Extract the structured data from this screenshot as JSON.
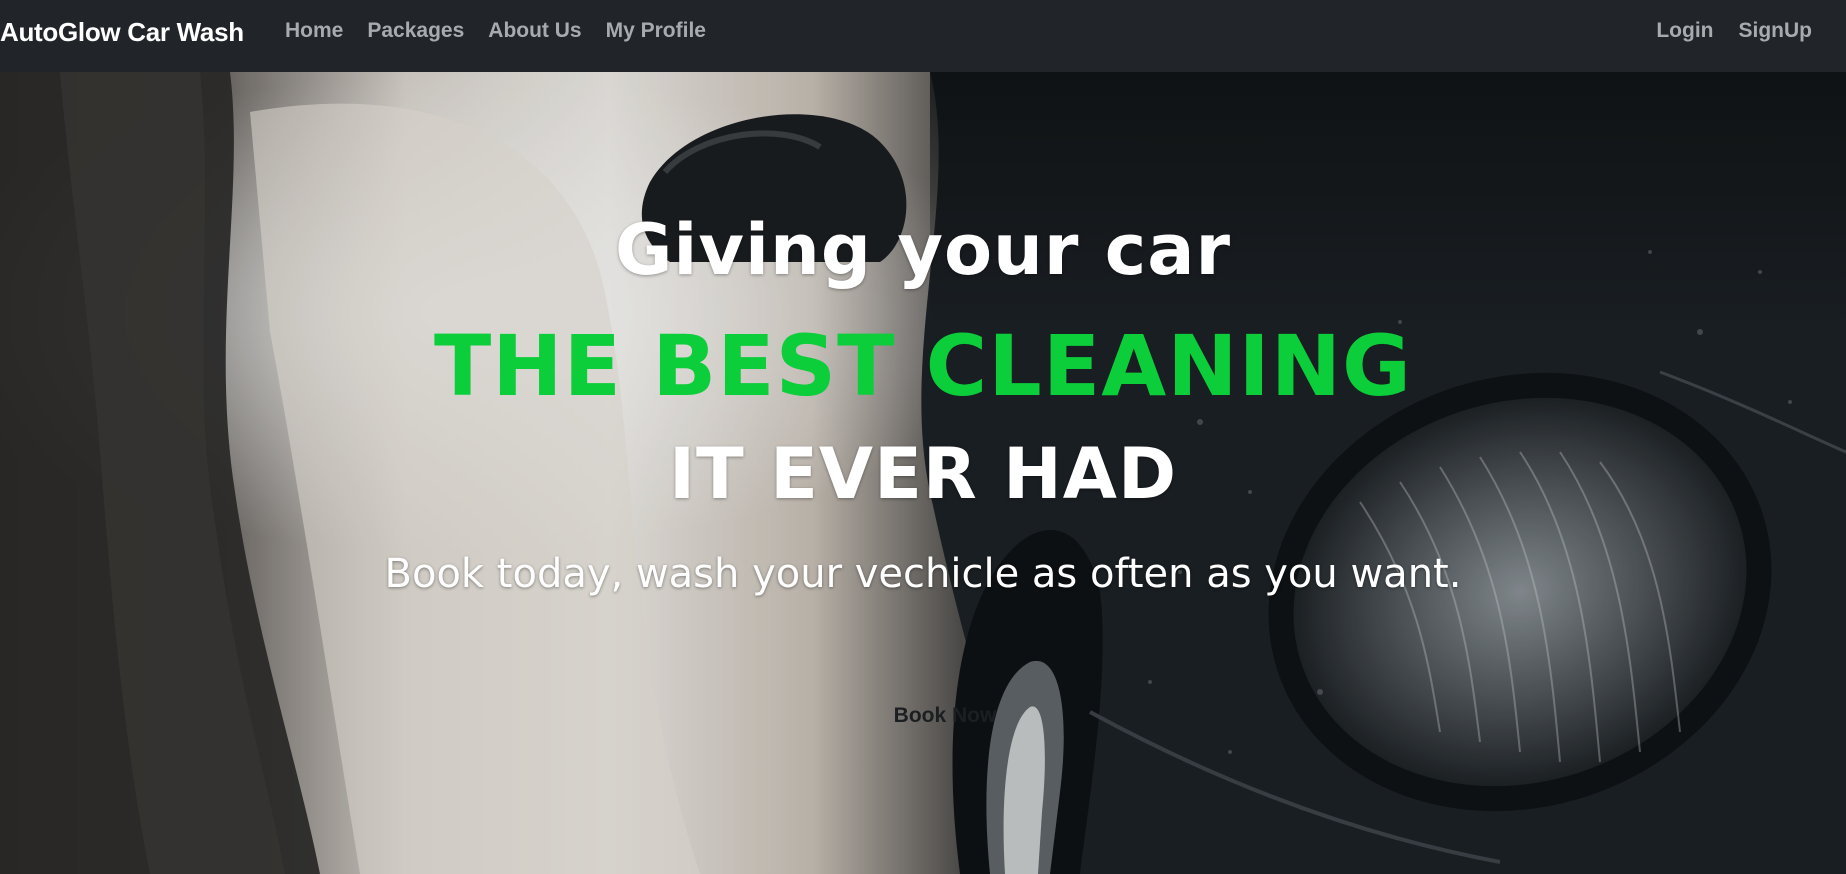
{
  "navbar": {
    "brand": "AutoGlow Car Wash",
    "left_links": [
      {
        "label": "Home"
      },
      {
        "label": "Packages"
      },
      {
        "label": "About Us"
      },
      {
        "label": "My Profile"
      }
    ],
    "right_links": [
      {
        "label": "Login"
      },
      {
        "label": "SignUp"
      }
    ],
    "background": "#212428",
    "link_color": "#a8abae"
  },
  "hero": {
    "line1": "Giving your car",
    "line2": "THE BEST CLEANING",
    "line3": "IT EVER HAD",
    "subtitle": "Book today, wash your vechicle as often as you want.",
    "cta_label": "Book Now",
    "accent_color": "#0ccd3a",
    "background_image": "car-wash-video-frame"
  }
}
